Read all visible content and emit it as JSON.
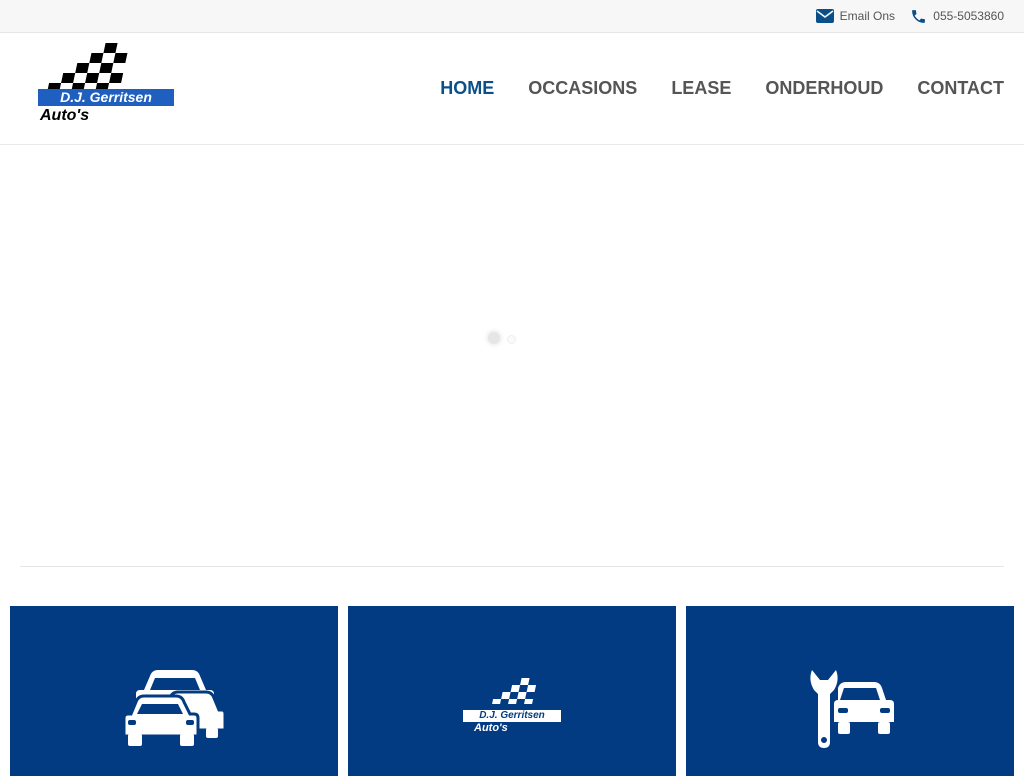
{
  "topbar": {
    "email_label": "Email Ons",
    "email_icon": "envelope-icon",
    "phone_label": "055-5053860",
    "phone_icon": "phone-icon"
  },
  "brand": {
    "logo_line1": "D.J. Gerritsen",
    "logo_line2": "Auto's",
    "primary_color": "#033b82",
    "logo_band_color": "#1f5fbf"
  },
  "nav": {
    "items": [
      {
        "label": "HOME",
        "active": true
      },
      {
        "label": "OCCASIONS",
        "active": false
      },
      {
        "label": "LEASE",
        "active": false
      },
      {
        "label": "ONDERHOUD",
        "active": false
      },
      {
        "label": "CONTACT",
        "active": false
      }
    ],
    "active_color": "#0b4f8a"
  },
  "hero": {
    "state": "loading"
  },
  "tiles": [
    {
      "icon": "cars-icon"
    },
    {
      "icon": "dj-gerritsen-logo-icon",
      "logo_line1": "D.J. Gerritsen",
      "logo_line2": "Auto's"
    },
    {
      "icon": "wrench-car-icon"
    }
  ]
}
